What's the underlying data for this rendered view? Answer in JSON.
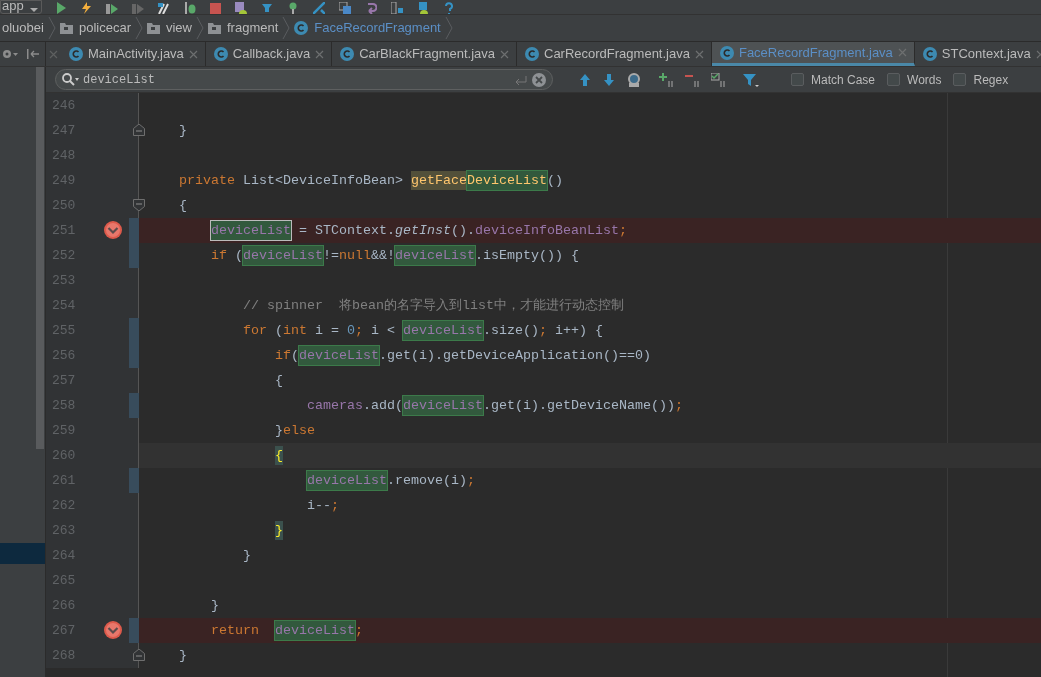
{
  "toolbar": {
    "config": "app"
  },
  "breadcrumb": [
    {
      "label": "oluobei",
      "kind": "folder-cut"
    },
    {
      "label": "policecar",
      "kind": "folder"
    },
    {
      "label": "view",
      "kind": "folder"
    },
    {
      "label": "fragment",
      "kind": "folder"
    },
    {
      "label": "FaceRecordFragment",
      "kind": "class"
    }
  ],
  "tabs": [
    {
      "label": "MainActivity.java",
      "selected": false
    },
    {
      "label": "Callback.java",
      "selected": false
    },
    {
      "label": "CarBlackFragment.java",
      "selected": false
    },
    {
      "label": "CarRecordFragment.java",
      "selected": false
    },
    {
      "label": "FaceRecordFragment.java",
      "selected": true
    },
    {
      "label": "STContext.java",
      "selected": false
    }
  ],
  "search": {
    "value": "deviceList",
    "options": [
      {
        "label": "Match Case",
        "checked": false
      },
      {
        "label": "Words",
        "checked": false
      },
      {
        "label": "Regex",
        "checked": false
      }
    ]
  },
  "lines": [
    {
      "number": "246"
    },
    {
      "number": "247",
      "fold_end": true,
      "tokens": [
        {
          "text": "    }",
          "kind": "plain"
        }
      ]
    },
    {
      "number": "248"
    },
    {
      "number": "249",
      "tokens": [
        {
          "text": "    private",
          "kind": "kw"
        },
        {
          "text": " List<DeviceInfoBean> ",
          "kind": "plain"
        },
        {
          "text": "getFace",
          "kind": "decl",
          "usage": true
        },
        {
          "text": "DeviceList",
          "kind": "decl",
          "search_match": true
        },
        {
          "text": "()",
          "kind": "plain"
        }
      ]
    },
    {
      "number": "250",
      "fold_start": true,
      "tokens": [
        {
          "text": "    {",
          "kind": "plain"
        }
      ]
    },
    {
      "number": "251",
      "breakpoint": true,
      "changed": true,
      "tokens": [
        {
          "text": "        deviceList",
          "kind": "field",
          "search_match": true,
          "current_match": true
        },
        {
          "text": " = STContext.",
          "kind": "plain"
        },
        {
          "text": "getInst",
          "kind": "italic"
        },
        {
          "text": "().",
          "kind": "plain"
        },
        {
          "text": "deviceInfoBeanList",
          "kind": "field"
        },
        {
          "text": ";",
          "kind": "kw"
        }
      ]
    },
    {
      "number": "252",
      "changed": true,
      "tokens": [
        {
          "text": "        if",
          "kind": "kw"
        },
        {
          "text": " (",
          "kind": "plain"
        },
        {
          "text": "deviceList",
          "kind": "field",
          "search_match": true
        },
        {
          "text": "!=",
          "kind": "plain"
        },
        {
          "text": "null",
          "kind": "kw"
        },
        {
          "text": "&&!",
          "kind": "plain"
        },
        {
          "text": "deviceList",
          "kind": "field",
          "search_match": true
        },
        {
          "text": ".isEmpty()) {",
          "kind": "plain"
        }
      ]
    },
    {
      "number": "253"
    },
    {
      "number": "254",
      "tokens": [
        {
          "text": "            // spinner  将bean的名字导入到list中，才能进行动态控制",
          "kind": "comment"
        }
      ]
    },
    {
      "number": "255",
      "changed": true,
      "tokens": [
        {
          "text": "            for",
          "kind": "kw"
        },
        {
          "text": " (",
          "kind": "plain"
        },
        {
          "text": "int",
          "kind": "kw"
        },
        {
          "text": " i = ",
          "kind": "plain"
        },
        {
          "text": "0",
          "kind": "num"
        },
        {
          "text": ";",
          "kind": "kw"
        },
        {
          "text": " i < ",
          "kind": "plain"
        },
        {
          "text": "deviceList",
          "kind": "field",
          "search_match": true
        },
        {
          "text": ".size()",
          "kind": "plain"
        },
        {
          "text": ";",
          "kind": "kw"
        },
        {
          "text": " i++) {",
          "kind": "plain"
        }
      ]
    },
    {
      "number": "256",
      "changed": true,
      "tokens": [
        {
          "text": "                if",
          "kind": "kw"
        },
        {
          "text": "(",
          "kind": "plain"
        },
        {
          "text": "deviceList",
          "kind": "field",
          "search_match": true
        },
        {
          "text": ".get(i).getDeviceApplication()==0)",
          "kind": "plain"
        }
      ]
    },
    {
      "number": "257",
      "tokens": [
        {
          "text": "                {",
          "kind": "plain"
        }
      ]
    },
    {
      "number": "258",
      "changed": true,
      "tokens": [
        {
          "text": "                    cameras",
          "kind": "field"
        },
        {
          "text": ".add(",
          "kind": "plain"
        },
        {
          "text": "deviceList",
          "kind": "field",
          "search_match": true
        },
        {
          "text": ".get(i).getDeviceName())",
          "kind": "plain"
        },
        {
          "text": ";",
          "kind": "kw"
        }
      ]
    },
    {
      "number": "259",
      "tokens": [
        {
          "text": "                }",
          "kind": "plain"
        },
        {
          "text": "else",
          "kind": "kw"
        }
      ]
    },
    {
      "number": "260",
      "caret_line": true,
      "tokens": [
        {
          "text": "                {",
          "kind": "brace"
        }
      ]
    },
    {
      "number": "261",
      "changed": true,
      "tokens": [
        {
          "text": "                    deviceList",
          "kind": "field",
          "search_match": true
        },
        {
          "text": ".remove(i)",
          "kind": "plain"
        },
        {
          "text": ";",
          "kind": "kw"
        }
      ]
    },
    {
      "number": "262",
      "tokens": [
        {
          "text": "                    i--",
          "kind": "plain"
        },
        {
          "text": ";",
          "kind": "kw"
        }
      ]
    },
    {
      "number": "263",
      "tokens": [
        {
          "text": "                }",
          "kind": "brace"
        }
      ]
    },
    {
      "number": "264",
      "tokens": [
        {
          "text": "            }",
          "kind": "plain"
        }
      ]
    },
    {
      "number": "265"
    },
    {
      "number": "266",
      "tokens": [
        {
          "text": "        }",
          "kind": "plain"
        }
      ]
    },
    {
      "number": "267",
      "breakpoint": true,
      "changed": true,
      "tokens": [
        {
          "text": "        return",
          "kind": "kw"
        },
        {
          "text": "  deviceList",
          "kind": "field",
          "search_match": true
        },
        {
          "text": ";",
          "kind": "kw"
        }
      ]
    },
    {
      "number": "268",
      "fold_end": true,
      "tokens": [
        {
          "text": "    }",
          "kind": "plain"
        }
      ]
    }
  ]
}
